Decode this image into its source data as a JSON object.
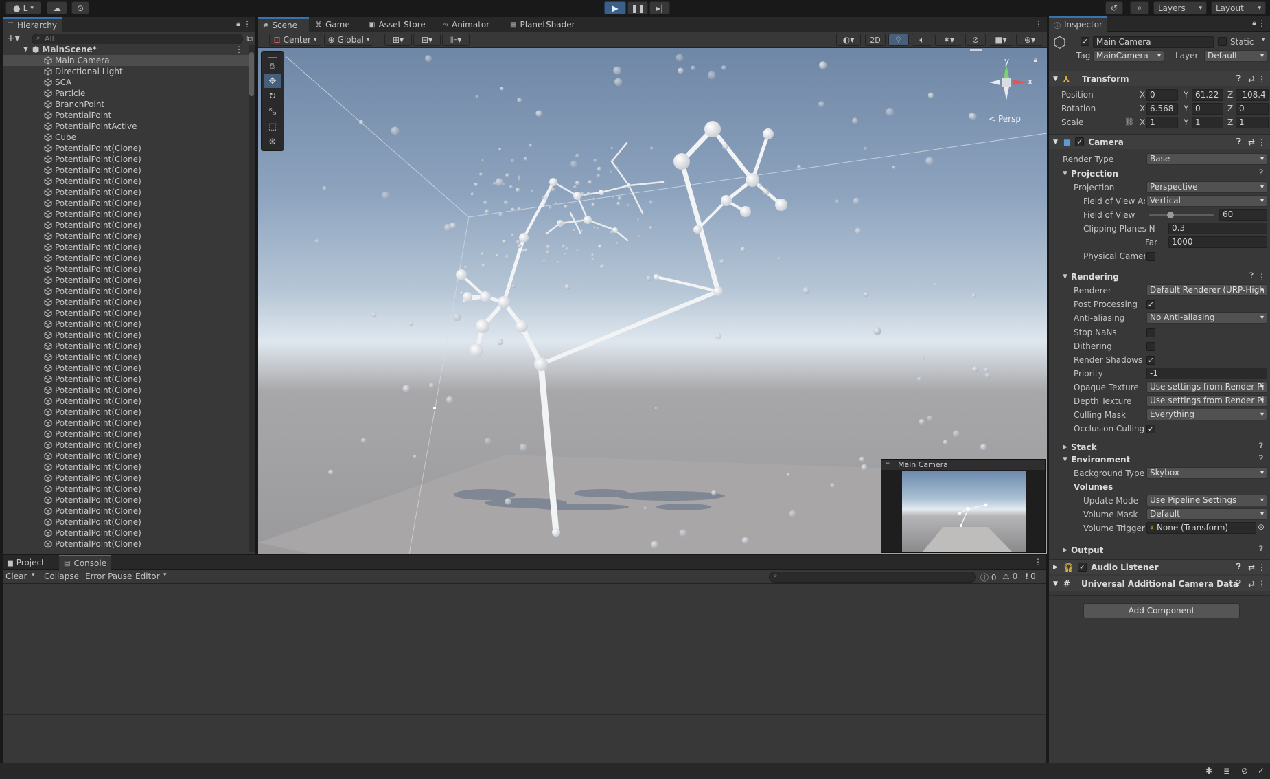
{
  "toolbar": {
    "account_label": "L",
    "layers_label": "Layers",
    "layout_label": "Layout"
  },
  "hierarchy": {
    "tab_label": "Hierarchy",
    "search_placeholder": "All",
    "scene_name": "MainScene*",
    "items": [
      "Main Camera",
      "Directional Light",
      "SCA",
      "Particle",
      "BranchPoint",
      "PotentialPoint",
      "PotentialPointActive",
      "Cube",
      "PotentialPoint(Clone)",
      "PotentialPoint(Clone)",
      "PotentialPoint(Clone)",
      "PotentialPoint(Clone)",
      "PotentialPoint(Clone)",
      "PotentialPoint(Clone)",
      "PotentialPoint(Clone)",
      "PotentialPoint(Clone)",
      "PotentialPoint(Clone)",
      "PotentialPoint(Clone)",
      "PotentialPoint(Clone)",
      "PotentialPoint(Clone)",
      "PotentialPoint(Clone)",
      "PotentialPoint(Clone)",
      "PotentialPoint(Clone)",
      "PotentialPoint(Clone)",
      "PotentialPoint(Clone)",
      "PotentialPoint(Clone)",
      "PotentialPoint(Clone)",
      "PotentialPoint(Clone)",
      "PotentialPoint(Clone)",
      "PotentialPoint(Clone)",
      "PotentialPoint(Clone)",
      "PotentialPoint(Clone)",
      "PotentialPoint(Clone)",
      "PotentialPoint(Clone)",
      "PotentialPoint(Clone)",
      "PotentialPoint(Clone)",
      "PotentialPoint(Clone)",
      "PotentialPoint(Clone)",
      "PotentialPoint(Clone)",
      "PotentialPoint(Clone)",
      "PotentialPoint(Clone)",
      "PotentialPoint(Clone)",
      "PotentialPoint(Clone)",
      "PotentialPoint(Clone)",
      "PotentialPoint(Clone)",
      "PotentialPoint(Clone)",
      "PotentialPoint(Clone)"
    ]
  },
  "scene_tabs": [
    "Scene",
    "Game",
    "Asset Store",
    "Animator",
    "PlanetShader"
  ],
  "scene_toolbar": {
    "pivot": "Center",
    "space": "Global",
    "mode_2d": "2D"
  },
  "scene_view": {
    "persp_label": "< Persp",
    "gizmo_y": "y",
    "gizmo_x": "x",
    "camera_preview_title": "Main Camera"
  },
  "inspector": {
    "tab_label": "Inspector",
    "object_name": "Main Camera",
    "static_label": "Static",
    "tag_label": "Tag",
    "tag_value": "MainCamera",
    "layer_label": "Layer",
    "layer_value": "Default",
    "transform": {
      "title": "Transform",
      "position_label": "Position",
      "position": {
        "x": "0",
        "y": "61.22",
        "z": "-108.4"
      },
      "rotation_label": "Rotation",
      "rotation": {
        "x": "6.568",
        "y": "0",
        "z": "0"
      },
      "scale_label": "Scale",
      "scale": {
        "x": "1",
        "y": "1",
        "z": "1"
      },
      "axis_x": "X",
      "axis_y": "Y",
      "axis_z": "Z"
    },
    "camera": {
      "title": "Camera",
      "render_type_label": "Render Type",
      "render_type": "Base",
      "projection_section": "Projection",
      "projection_label": "Projection",
      "projection_value": "Perspective",
      "fov_axis_label": "Field of View Ax",
      "fov_axis_value": "Vertical",
      "fov_label": "Field of View",
      "fov_value": "60",
      "fov_fraction": 0.33,
      "clip_label": "Clipping Planes Near",
      "clip_near": "0.3",
      "clip_far_label": "Far",
      "clip_far": "1000",
      "physical_label": "Physical Camer",
      "rendering_section": "Rendering",
      "renderer_label": "Renderer",
      "renderer_value": "Default Renderer (URP-High",
      "post_label": "Post Processing",
      "aa_label": "Anti-aliasing",
      "aa_value": "No Anti-aliasing",
      "stopnans_label": "Stop NaNs",
      "dither_label": "Dithering",
      "shadows_label": "Render Shadows",
      "priority_label": "Priority",
      "priority_value": "-1",
      "opaque_label": "Opaque Texture",
      "opaque_value": "Use settings from Render Pi",
      "depth_label": "Depth Texture",
      "depth_value": "Use settings from Render Pi",
      "culling_label": "Culling Mask",
      "culling_value": "Everything",
      "occlusion_label": "Occlusion Culling",
      "stack_section": "Stack",
      "environment_section": "Environment",
      "bg_label": "Background Type",
      "bg_value": "Skybox",
      "volumes_section": "Volumes",
      "update_label": "Update Mode",
      "update_value": "Use Pipeline Settings",
      "vmask_label": "Volume Mask",
      "vmask_value": "Default",
      "vtrigger_label": "Volume Trigger",
      "vtrigger_value": "None (Transform)",
      "output_section": "Output"
    },
    "audio_listener": "Audio Listener",
    "urp_camera_data": "Universal Additional Camera Data",
    "add_component": "Add Component"
  },
  "console": {
    "tabs": [
      "Project",
      "Console"
    ],
    "clear": "Clear",
    "collapse": "Collapse",
    "error_pause": "Error Pause",
    "editor": "Editor",
    "info_count": "0",
    "warn_count": "0",
    "error_count": "0"
  },
  "colors": {
    "accent": "#3a72b0",
    "play_active": "#3a5f8a",
    "panel": "#383838",
    "transform_icon": "#e0b030",
    "camera_icon": "#5a9bd5"
  }
}
